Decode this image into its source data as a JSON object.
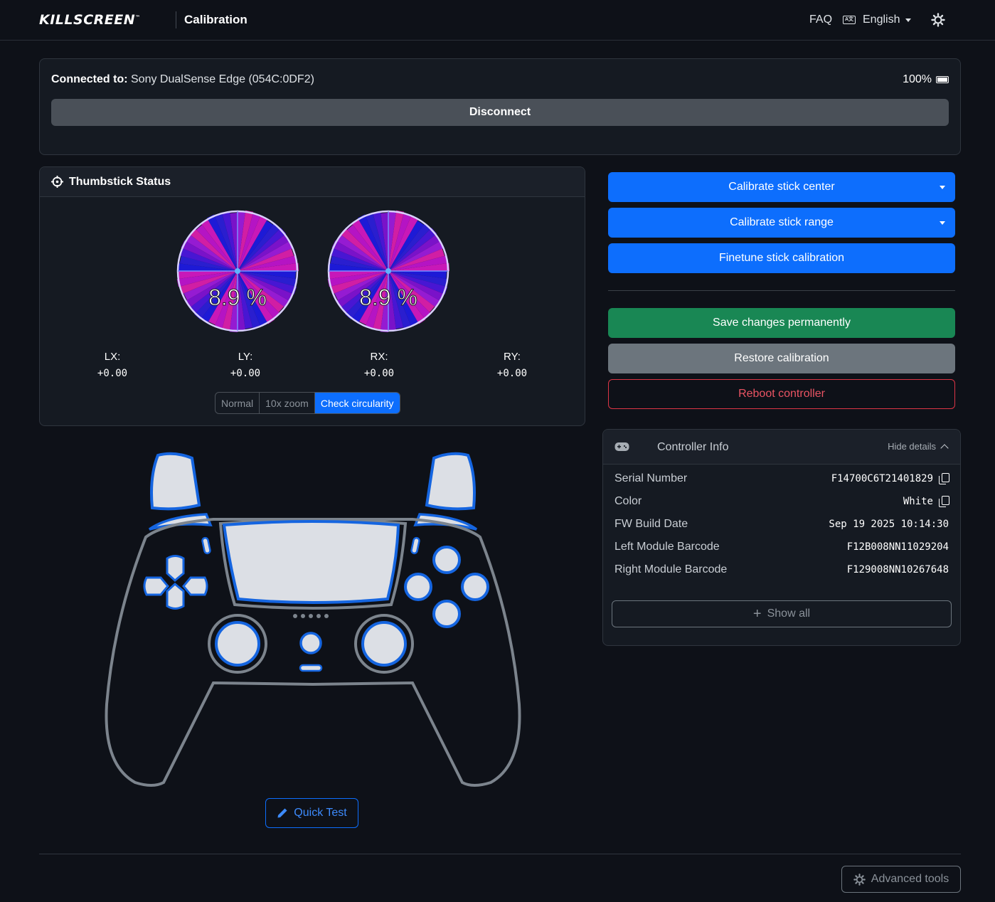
{
  "navbar": {
    "brand": "KILLSCREEN",
    "brand_tm": "™",
    "subtitle": "Calibration",
    "faq": "FAQ",
    "language": "English",
    "theme_icon": "gear-icon"
  },
  "connection": {
    "label": "Connected to:",
    "device": "Sony DualSense Edge (054C:0DF2)",
    "battery": "100%",
    "disconnect": "Disconnect"
  },
  "thumbstick": {
    "title": "Thumbstick Status",
    "left_percent": "8.9 %",
    "right_percent": "8.9 %",
    "axes": [
      {
        "label": "LX:",
        "value": "+0.00"
      },
      {
        "label": "LY:",
        "value": "+0.00"
      },
      {
        "label": "RX:",
        "value": "+0.00"
      },
      {
        "label": "RY:",
        "value": "+0.00"
      }
    ],
    "modes": [
      "Normal",
      "10x zoom",
      "Check circularity"
    ],
    "active_mode": "Check circularity"
  },
  "actions": {
    "calibrate_center": "Calibrate stick center",
    "calibrate_range": "Calibrate stick range",
    "finetune": "Finetune stick calibration",
    "save": "Save changes permanently",
    "restore": "Restore calibration",
    "reboot": "Reboot controller"
  },
  "controller_info": {
    "title": "Controller Info",
    "hide_details": "Hide details",
    "rows": [
      {
        "key": "Serial Number",
        "value": "F14700C6T21401829"
      },
      {
        "key": "Color",
        "value": "White"
      },
      {
        "key": "FW Build Date",
        "value": "Sep 19 2025 10:14:30"
      },
      {
        "key": "Left Module Barcode",
        "value": "F12B008NN11029204"
      },
      {
        "key": "Right Module Barcode",
        "value": "F129008NN10267648"
      }
    ],
    "show_all": "Show all"
  },
  "quick_test": "Quick Test",
  "advanced_tools": "Advanced tools",
  "colors": {
    "primary": "#0d6efd",
    "success": "#198754",
    "secondary": "#6c757d",
    "danger": "#dc3545",
    "background": "#0e1118",
    "accent_outline": "#1565e0"
  }
}
